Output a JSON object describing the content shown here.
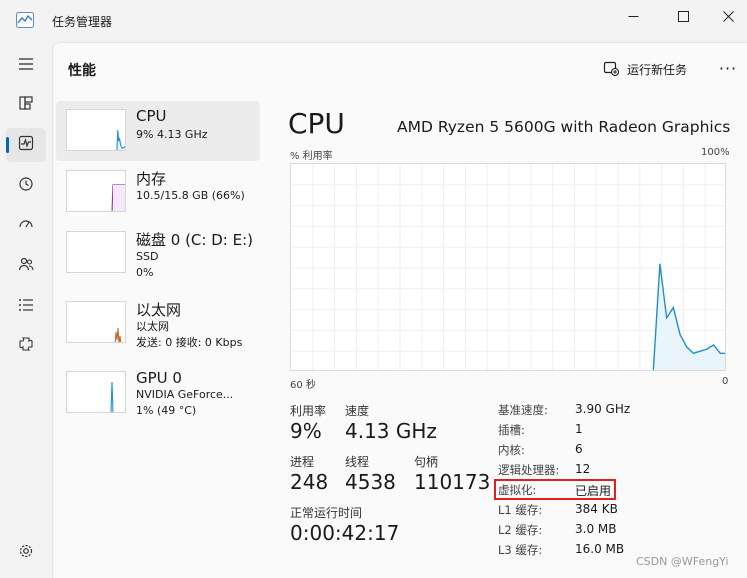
{
  "window": {
    "title": "任务管理器"
  },
  "nav": {
    "items": [
      {
        "icon": "hamburger-menu-icon",
        "active": false
      },
      {
        "icon": "processes-icon",
        "active": false
      },
      {
        "icon": "performance-icon",
        "active": true
      },
      {
        "icon": "app-history-icon",
        "active": false
      },
      {
        "icon": "startup-apps-icon",
        "active": false
      },
      {
        "icon": "users-icon",
        "active": false
      },
      {
        "icon": "details-icon",
        "active": false
      },
      {
        "icon": "services-icon",
        "active": false
      },
      {
        "icon": "settings-icon",
        "active": false
      }
    ]
  },
  "header": {
    "page_title": "性能",
    "run_new_task": "运行新任务",
    "more": "···"
  },
  "resources": [
    {
      "name": "CPU",
      "sub1": "9%  4.13 GHz",
      "sub2": "",
      "sub3": ""
    },
    {
      "name": "内存",
      "sub1": "10.5/15.8 GB (66%)",
      "sub2": "",
      "sub3": ""
    },
    {
      "name": "磁盘 0 (C: D: E:)",
      "sub1": "SSD",
      "sub2": "0%",
      "sub3": ""
    },
    {
      "name": "以太网",
      "sub1": "以太网",
      "sub2": "发送: 0 接收: 0 Kbps",
      "sub3": ""
    },
    {
      "name": "GPU 0",
      "sub1": "NVIDIA GeForce...",
      "sub2": "1% (49 °C)",
      "sub3": ""
    }
  ],
  "detail": {
    "title": "CPU",
    "model": "AMD Ryzen 5 5600G with Radeon Graphics",
    "graph_ylabel": "% 利用率",
    "graph_ymax": "100%",
    "graph_xleft": "60 秒",
    "graph_xright": "0",
    "utilization_series": [
      0,
      0,
      0,
      0,
      0,
      0,
      0,
      0,
      0,
      0,
      0,
      0,
      0,
      0,
      0,
      0,
      0,
      0,
      0,
      0,
      0,
      0,
      0,
      0,
      0,
      0,
      0,
      0,
      0,
      0,
      0,
      0,
      0,
      0,
      0,
      0,
      0,
      0,
      0,
      0,
      0,
      0,
      0,
      0,
      0,
      0,
      0,
      0,
      0,
      0,
      0,
      0,
      0,
      0,
      0,
      52,
      26,
      31,
      18,
      12,
      9,
      10,
      11,
      13,
      9,
      9
    ]
  },
  "stats": {
    "utilization_label": "利用率",
    "utilization_value": "9%",
    "speed_label": "速度",
    "speed_value": "4.13 GHz",
    "processes_label": "进程",
    "processes_value": "248",
    "threads_label": "线程",
    "threads_value": "4538",
    "handles_label": "句柄",
    "handles_value": "110173",
    "uptime_label": "正常运行时间",
    "uptime_value": "0:00:42:17"
  },
  "specs": [
    {
      "key": "基准速度:",
      "value": "3.90 GHz"
    },
    {
      "key": "插槽:",
      "value": "1"
    },
    {
      "key": "内核:",
      "value": "6"
    },
    {
      "key": "逻辑处理器:",
      "value": "12"
    },
    {
      "key": "虚拟化:",
      "value": "已启用"
    },
    {
      "key": "L1 缓存:",
      "value": "384 KB"
    },
    {
      "key": "L2 缓存:",
      "value": "3.0 MB"
    },
    {
      "key": "L3 缓存:",
      "value": "16.0 MB"
    }
  ],
  "watermark": "CSDN @WFengYi",
  "colors": {
    "accent": "#0067c0",
    "cpu_line": "#1c8fd6",
    "cpu_fill": "#eaf4fb",
    "memory_line": "#8f3ebf",
    "ethernet_line": "#c0631a",
    "highlight_border": "#e02020"
  }
}
